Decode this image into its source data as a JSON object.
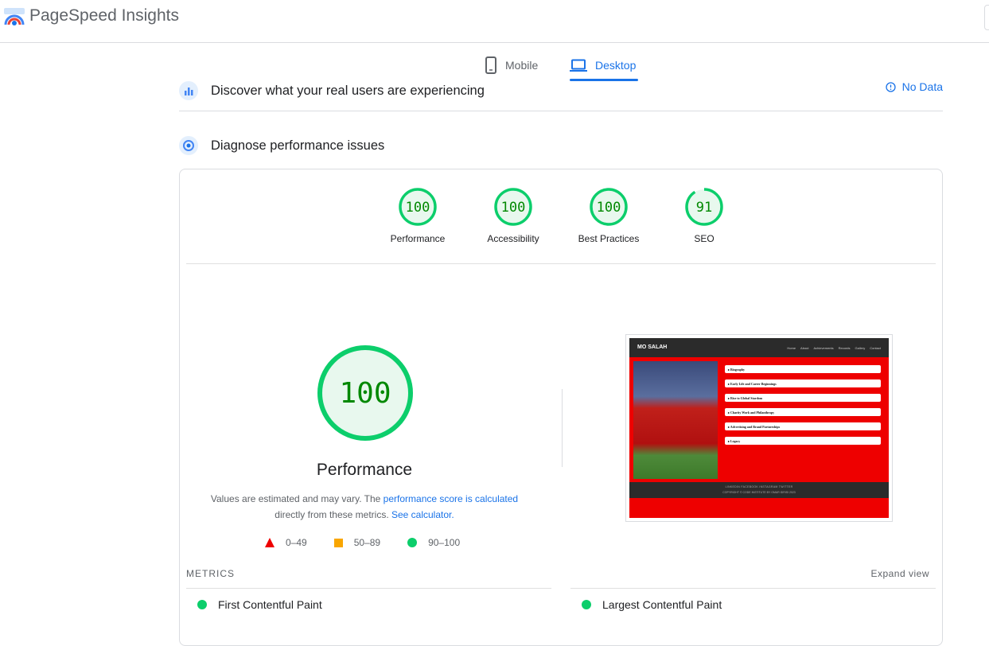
{
  "app": {
    "title": "PageSpeed Insights",
    "logo_icon": "pagespeed-logo-icon"
  },
  "tabs": [
    {
      "label": "Mobile",
      "icon": "smartphone-icon",
      "selected": false
    },
    {
      "label": "Desktop",
      "icon": "laptop-icon",
      "selected": true
    }
  ],
  "crux": {
    "title": "Discover what your real users are experiencing",
    "status": "No Data",
    "icon": "users-chart-icon",
    "status_icon": "info-icon"
  },
  "diagnose": {
    "title": "Diagnose performance issues",
    "icon": "lighthouse-icon"
  },
  "scores": [
    {
      "label": "Performance",
      "value": 100
    },
    {
      "label": "Accessibility",
      "value": 100
    },
    {
      "label": "Best Practices",
      "value": 100
    },
    {
      "label": "SEO",
      "value": 91
    }
  ],
  "performance": {
    "score": 100,
    "title": "Performance",
    "note_1": "Values are estimated and may vary. The ",
    "note_link_1": "performance score is calculated",
    "note_2": "directly from these metrics. ",
    "note_link_2": "See calculator."
  },
  "legend": [
    {
      "range": "0–49",
      "shape": "triangle",
      "color": "#ee0000"
    },
    {
      "range": "50–89",
      "shape": "square",
      "color": "#f9a600"
    },
    {
      "range": "90–100",
      "shape": "circle",
      "color": "#0cce6b"
    }
  ],
  "screenshot": {
    "brand": "MO SALAH",
    "nav": [
      "Home",
      "About",
      "Achievements",
      "Records",
      "Gallery",
      "Contact"
    ],
    "items": [
      "Biography",
      "Early Life and Career Beginnings",
      "Rise to Global Stardom",
      "Charity Work and Philanthropy",
      "Advertising and Brand Partnerships",
      "Legacy"
    ],
    "footer_links": "LINKEDIN    FACEBOOK    INSTAGRAM    TWITTER",
    "footer_copy": "COPYRIGHT © CODE INSTITUTE BY OMAR IDRISI 2023"
  },
  "metrics": {
    "label": "METRICS",
    "expand": "Expand view",
    "items": [
      {
        "label": "First Contentful Paint"
      },
      {
        "label": "Largest Contentful Paint"
      }
    ]
  },
  "colors": {
    "pass": "#0cce6b",
    "pass_text": "#008800",
    "pass_bg": "#e8f8ee",
    "accent": "#1a73e8"
  }
}
